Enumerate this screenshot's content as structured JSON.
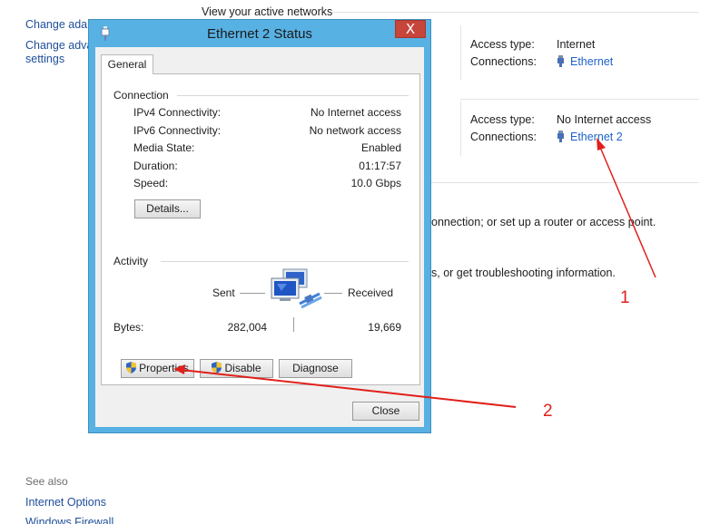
{
  "background": {
    "sidebar_links": [
      "Change adap",
      "Change adva",
      "settings"
    ],
    "heading": "View your active networks",
    "networks": [
      {
        "access_type_label": "Access type:",
        "access_type": "Internet",
        "connections_label": "Connections:",
        "connection": "Ethernet"
      },
      {
        "access_type_label": "Access type:",
        "access_type": "No Internet access",
        "connections_label": "Connections:",
        "connection": "Ethernet 2"
      }
    ],
    "text_line_1": "onnection; or set up a router or access point.",
    "text_line_2": "s, or get troubleshooting information.",
    "see_also": "See also",
    "see_also_links": [
      "Internet Options",
      "Windows Firewall"
    ]
  },
  "dialog": {
    "title": "Ethernet 2 Status",
    "close_glyph": "X",
    "tab": "General",
    "connection_group": "Connection",
    "fields": [
      {
        "label": "IPv4 Connectivity:",
        "value": "No Internet access"
      },
      {
        "label": "IPv6 Connectivity:",
        "value": "No network access"
      },
      {
        "label": "Media State:",
        "value": "Enabled"
      },
      {
        "label": "Duration:",
        "value": "01:17:57"
      },
      {
        "label": "Speed:",
        "value": "10.0 Gbps"
      }
    ],
    "details_button": "Details...",
    "activity_group": "Activity",
    "sent_label": "Sent",
    "received_label": "Received",
    "bytes_label": "Bytes:",
    "bytes_sent": "282,004",
    "bytes_received": "19,669",
    "properties_button": "Properties",
    "disable_button": "Disable",
    "diagnose_button": "Diagnose",
    "close_button": "Close"
  },
  "annotations": {
    "marker_1": "1",
    "marker_2": "2",
    "color": "#e0201a"
  },
  "colors": {
    "title_bar": "#58b1e3",
    "close_button": "#c7453a",
    "link": "#1e62c8"
  }
}
